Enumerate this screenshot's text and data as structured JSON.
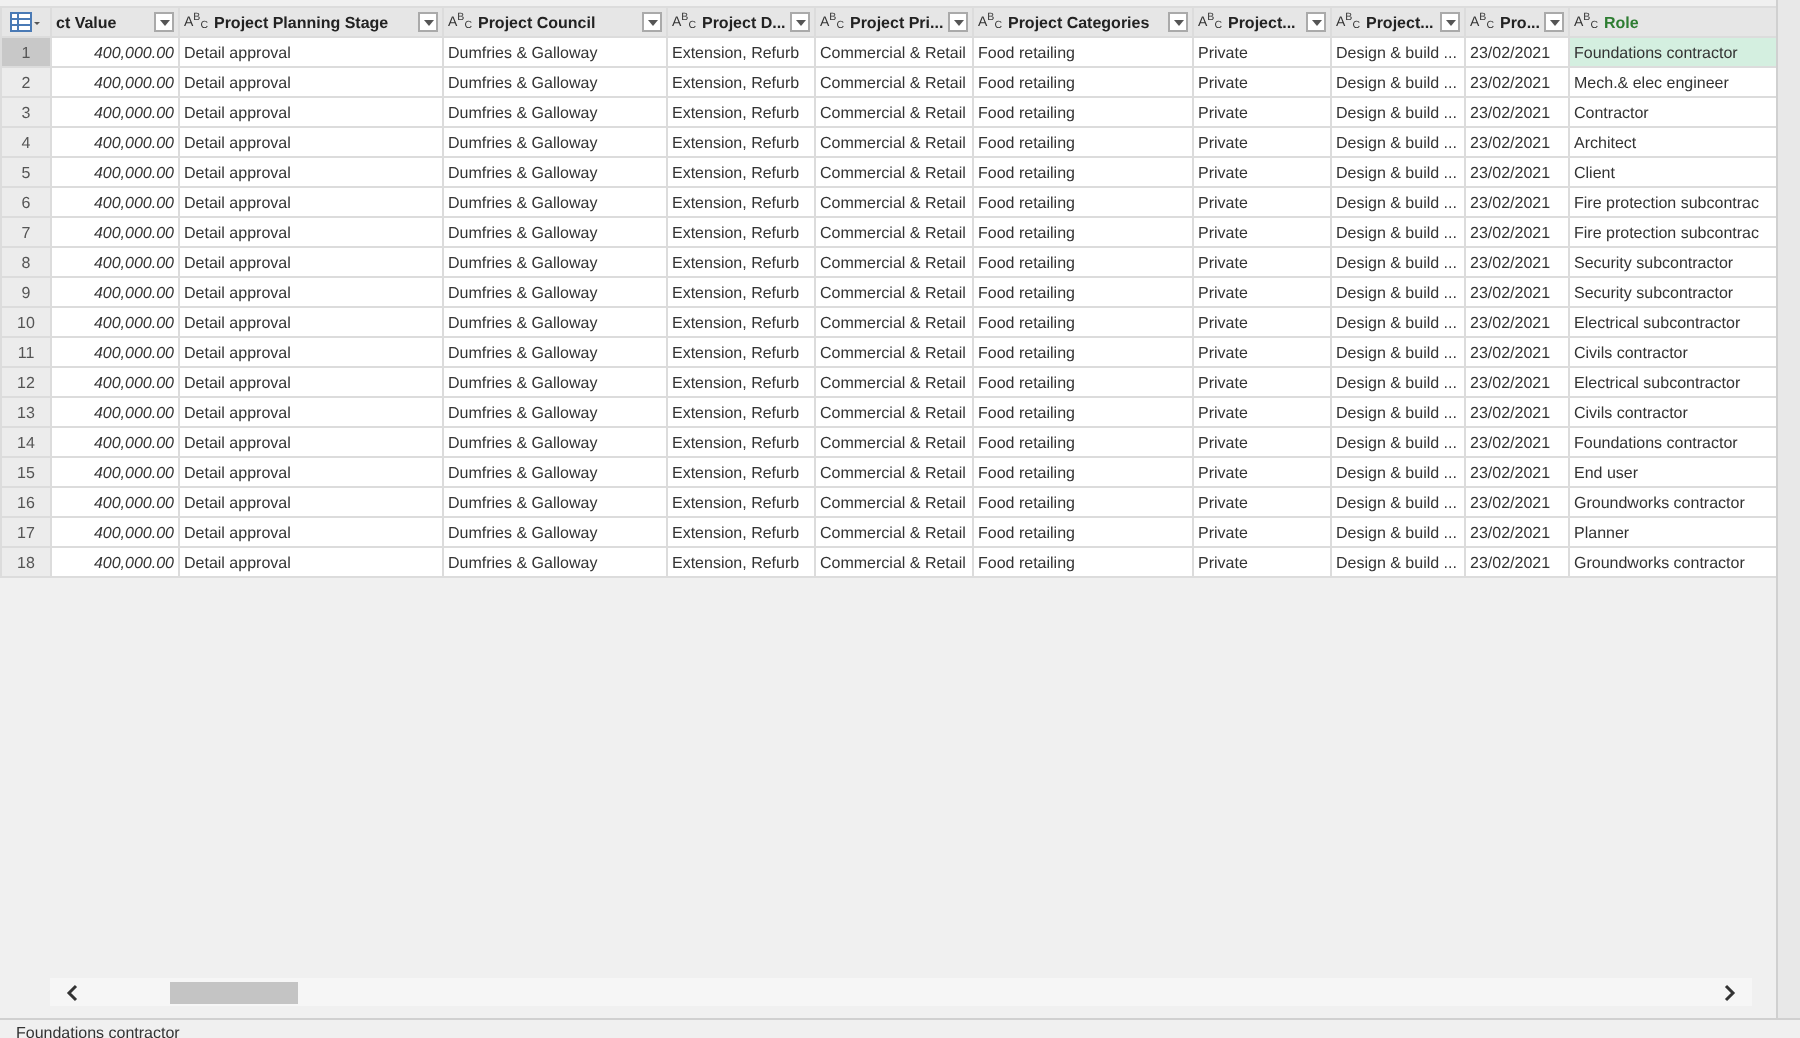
{
  "columns": [
    {
      "name": "ct Value",
      "selected": false
    },
    {
      "name": "Project Planning Stage",
      "type_badge": "A$^{B}$$_{C}$",
      "selected": false
    },
    {
      "name": "Project Council",
      "type_badge": "A$^{B}$$_{C}$",
      "selected": false
    },
    {
      "name": "Project D...",
      "type_badge": "A$^{B}$$_{C}$",
      "selected": false
    },
    {
      "name": "Project Pri...",
      "type_badge": "A$^{B}$$_{C}$",
      "selected": false
    },
    {
      "name": "Project Categories",
      "type_badge": "A$^{B}$$_{C}$",
      "selected": false
    },
    {
      "name": "Project...",
      "type_badge": "A$^{B}$$_{C}$",
      "selected": false
    },
    {
      "name": "Project...",
      "type_badge": "A$^{B}$$_{C}$",
      "selected": false
    },
    {
      "name": "Pro...",
      "type_badge": "A$^{B}$$_{C}$",
      "selected": false
    },
    {
      "name": "Role",
      "type_badge": "A$^{B}$$_{C}$",
      "selected": true
    }
  ],
  "rows": [
    {
      "num": "1",
      "selected": true,
      "cells": [
        "400,000.00",
        "Detail approval",
        "Dumfries & Galloway",
        "Extension, Refurb",
        "Commercial & Retail",
        "Food retailing",
        "Private",
        "Design & build ...",
        "23/02/2021",
        "Foundations contractor"
      ]
    },
    {
      "num": "2",
      "selected": false,
      "cells": [
        "400,000.00",
        "Detail approval",
        "Dumfries & Galloway",
        "Extension, Refurb",
        "Commercial & Retail",
        "Food retailing",
        "Private",
        "Design & build ...",
        "23/02/2021",
        "Mech.& elec engineer"
      ]
    },
    {
      "num": "3",
      "selected": false,
      "cells": [
        "400,000.00",
        "Detail approval",
        "Dumfries & Galloway",
        "Extension, Refurb",
        "Commercial & Retail",
        "Food retailing",
        "Private",
        "Design & build ...",
        "23/02/2021",
        "Contractor"
      ]
    },
    {
      "num": "4",
      "selected": false,
      "cells": [
        "400,000.00",
        "Detail approval",
        "Dumfries & Galloway",
        "Extension, Refurb",
        "Commercial & Retail",
        "Food retailing",
        "Private",
        "Design & build ...",
        "23/02/2021",
        "Architect"
      ]
    },
    {
      "num": "5",
      "selected": false,
      "cells": [
        "400,000.00",
        "Detail approval",
        "Dumfries & Galloway",
        "Extension, Refurb",
        "Commercial & Retail",
        "Food retailing",
        "Private",
        "Design & build ...",
        "23/02/2021",
        "Client"
      ]
    },
    {
      "num": "6",
      "selected": false,
      "cells": [
        "400,000.00",
        "Detail approval",
        "Dumfries & Galloway",
        "Extension, Refurb",
        "Commercial & Retail",
        "Food retailing",
        "Private",
        "Design & build ...",
        "23/02/2021",
        "Fire protection subcontrac"
      ]
    },
    {
      "num": "7",
      "selected": false,
      "cells": [
        "400,000.00",
        "Detail approval",
        "Dumfries & Galloway",
        "Extension, Refurb",
        "Commercial & Retail",
        "Food retailing",
        "Private",
        "Design & build ...",
        "23/02/2021",
        "Fire protection subcontrac"
      ]
    },
    {
      "num": "8",
      "selected": false,
      "cells": [
        "400,000.00",
        "Detail approval",
        "Dumfries & Galloway",
        "Extension, Refurb",
        "Commercial & Retail",
        "Food retailing",
        "Private",
        "Design & build ...",
        "23/02/2021",
        "Security subcontractor"
      ]
    },
    {
      "num": "9",
      "selected": false,
      "cells": [
        "400,000.00",
        "Detail approval",
        "Dumfries & Galloway",
        "Extension, Refurb",
        "Commercial & Retail",
        "Food retailing",
        "Private",
        "Design & build ...",
        "23/02/2021",
        "Security subcontractor"
      ]
    },
    {
      "num": "10",
      "selected": false,
      "cells": [
        "400,000.00",
        "Detail approval",
        "Dumfries & Galloway",
        "Extension, Refurb",
        "Commercial & Retail",
        "Food retailing",
        "Private",
        "Design & build ...",
        "23/02/2021",
        "Electrical subcontractor"
      ]
    },
    {
      "num": "11",
      "selected": false,
      "cells": [
        "400,000.00",
        "Detail approval",
        "Dumfries & Galloway",
        "Extension, Refurb",
        "Commercial & Retail",
        "Food retailing",
        "Private",
        "Design & build ...",
        "23/02/2021",
        "Civils contractor"
      ]
    },
    {
      "num": "12",
      "selected": false,
      "cells": [
        "400,000.00",
        "Detail approval",
        "Dumfries & Galloway",
        "Extension, Refurb",
        "Commercial & Retail",
        "Food retailing",
        "Private",
        "Design & build ...",
        "23/02/2021",
        "Electrical subcontractor"
      ]
    },
    {
      "num": "13",
      "selected": false,
      "cells": [
        "400,000.00",
        "Detail approval",
        "Dumfries & Galloway",
        "Extension, Refurb",
        "Commercial & Retail",
        "Food retailing",
        "Private",
        "Design & build ...",
        "23/02/2021",
        "Civils contractor"
      ]
    },
    {
      "num": "14",
      "selected": false,
      "cells": [
        "400,000.00",
        "Detail approval",
        "Dumfries & Galloway",
        "Extension, Refurb",
        "Commercial & Retail",
        "Food retailing",
        "Private",
        "Design & build ...",
        "23/02/2021",
        "Foundations contractor"
      ]
    },
    {
      "num": "15",
      "selected": false,
      "cells": [
        "400,000.00",
        "Detail approval",
        "Dumfries & Galloway",
        "Extension, Refurb",
        "Commercial & Retail",
        "Food retailing",
        "Private",
        "Design & build ...",
        "23/02/2021",
        "End user"
      ]
    },
    {
      "num": "16",
      "selected": false,
      "cells": [
        "400,000.00",
        "Detail approval",
        "Dumfries & Galloway",
        "Extension, Refurb",
        "Commercial & Retail",
        "Food retailing",
        "Private",
        "Design & build ...",
        "23/02/2021",
        "Groundworks contractor"
      ]
    },
    {
      "num": "17",
      "selected": false,
      "cells": [
        "400,000.00",
        "Detail approval",
        "Dumfries & Galloway",
        "Extension, Refurb",
        "Commercial & Retail",
        "Food retailing",
        "Private",
        "Design & build ...",
        "23/02/2021",
        "Planner"
      ]
    },
    {
      "num": "18",
      "selected": false,
      "cells": [
        "400,000.00",
        "Detail approval",
        "Dumfries & Galloway",
        "Extension, Refurb",
        "Commercial & Retail",
        "Food retailing",
        "Private",
        "Design & build ...",
        "23/02/2021",
        "Groundworks contractor"
      ]
    }
  ],
  "status_bar": {
    "text": "Foundations contractor"
  }
}
